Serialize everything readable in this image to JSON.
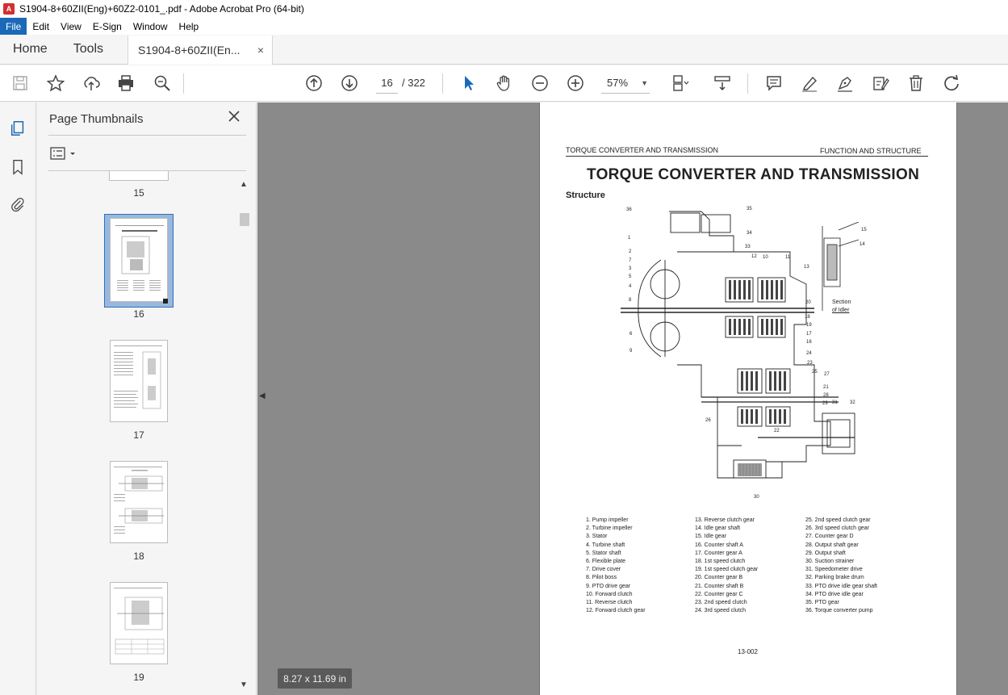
{
  "window": {
    "title": "S1904-8+60ZII(Eng)+60Z2-0101_.pdf - Adobe Acrobat Pro (64-bit)"
  },
  "menu": {
    "items": [
      "File",
      "Edit",
      "View",
      "E-Sign",
      "Window",
      "Help"
    ]
  },
  "tabs": {
    "home": "Home",
    "tools": "Tools",
    "document": "S1904-8+60ZII(En...",
    "close_glyph": "×"
  },
  "toolbar": {
    "current_page": "16",
    "total_pages": "/ 322",
    "zoom": "57%",
    "icons": [
      "save-icon",
      "star-icon",
      "upload-icon",
      "print-icon",
      "zoom-search-icon",
      "page-up-icon",
      "page-down-icon",
      "select-cursor-icon",
      "hand-icon",
      "zoom-out-icon",
      "zoom-in-icon",
      "page-display-icon",
      "scroll-mode-icon",
      "comment-icon",
      "highlight-icon",
      "sign-icon",
      "edit-pdf-icon",
      "delete-icon",
      "rotate-icon"
    ]
  },
  "thumbnail_panel": {
    "title": "Page Thumbnails",
    "pages": [
      "15",
      "16",
      "17",
      "18",
      "19"
    ],
    "selected_page": "16"
  },
  "document": {
    "page_size": "8.27 x 11.69 in",
    "header_left": "TORQUE CONVERTER AND TRANSMISSION",
    "header_right": "FUNCTION AND STRUCTURE",
    "title": "TORQUE CONVERTER AND TRANSMISSION",
    "section": "Structure",
    "idler_caption_1": "Section",
    "idler_caption_2": "of Idler",
    "page_number": "13-002",
    "legend_col1": [
      "1. Pump impeller",
      "2. Turbine impeller",
      "3. Stator",
      "4. Turbine shaft",
      "5. Stator shaft",
      "6. Flexible plate",
      "7. Drive cover",
      "8. Pilot boss",
      "9. PTO drive gear",
      "10. Forward clutch",
      "11. Reverse clutch",
      "12. Forward clutch gear"
    ],
    "legend_col2": [
      "13. Reverse clutch gear",
      "14. Idle gear shaft",
      "15. Idle gear",
      "16. Counter shaft A",
      "17. Counter gear A",
      "18. 1st speed clutch",
      "19. 1st speed clutch gear",
      "20. Counter gear B",
      "21. Counter shaft B",
      "22. Counter gear C",
      "23. 2nd speed clutch",
      "24. 3rd speed clutch"
    ],
    "legend_col3": [
      "25. 2nd speed clutch gear",
      "26. 3rd speed clutch gear",
      "27. Counter gear D",
      "28. Output shaft gear",
      "29. Output shaft",
      "30. Suction strainer",
      "31. Speedometer drive",
      "32. Parking brake drum",
      "33. PTO drive idle gear shaft",
      "34. PTO drive idle gear",
      "35. PTO gear",
      "36. Torque converter pump"
    ],
    "callouts": [
      "36",
      "35",
      "34",
      "33",
      "1",
      "2",
      "7",
      "3",
      "5",
      "4",
      "8",
      "6",
      "9",
      "12",
      "10",
      "11",
      "13",
      "20",
      "18",
      "19",
      "17",
      "16",
      "24",
      "23",
      "25",
      "27",
      "21",
      "28",
      "29",
      "31",
      "32",
      "26",
      "22",
      "30",
      "15",
      "14"
    ]
  },
  "colors": {
    "accent": "#1a6ab8",
    "viewport_bg": "#8a8a8a",
    "selected_thumb": "#9ab8dc"
  }
}
